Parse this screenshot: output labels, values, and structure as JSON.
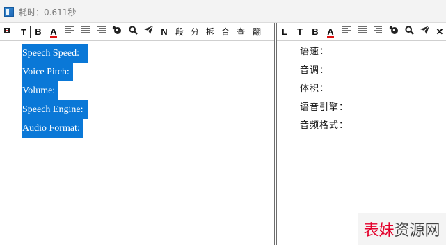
{
  "titlebar": {
    "title": "耗时：0.611秒"
  },
  "left_toolbar": {
    "text_btn": "T",
    "bold_btn": "B",
    "color_btn": "A",
    "n_btn": "N",
    "para_btn": "段",
    "split_btn": "分",
    "break_btn": "拆",
    "merge_btn": "合",
    "check_btn": "查",
    "translate_btn": "翻"
  },
  "right_toolbar": {
    "l_btn": "L",
    "text_btn": "T",
    "bold_btn": "B",
    "color_btn": "A",
    "close_btn": "✕"
  },
  "left_text": [
    "Speech Speed:",
    "Voice Pitch:",
    "Volume:",
    "Speech Engine:",
    "Audio Format:"
  ],
  "right_text": [
    "语速：",
    "音调：",
    "体积：",
    "语音引擎：",
    "音频格式："
  ],
  "watermark": {
    "red": "表妹",
    "gray": "资源网"
  },
  "colors": {
    "selection": "#0a78d7",
    "accent_red": "#e4002b"
  }
}
